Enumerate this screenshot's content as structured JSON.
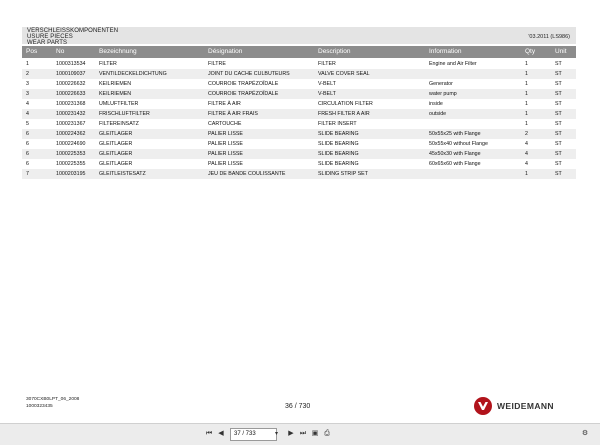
{
  "header": {
    "line1": "VERSCHLEISSKOMPONENTEN",
    "line2": "USURE PIECES",
    "line3": "WEAR PARTS",
    "date_ref": "'03.2011 (LS986)"
  },
  "columns": [
    "Pos",
    "No",
    "Bezeichnung",
    "Désignation",
    "Description",
    "Information",
    "Qty",
    "Unit"
  ],
  "rows": [
    {
      "pos": "1",
      "no": "1000313534",
      "bez": "FILTER",
      "des": "FILTRE",
      "desc": "FILTER",
      "info": "Engine and Air Filter",
      "qty": "1",
      "unit": "ST"
    },
    {
      "pos": "2",
      "no": "1000109037",
      "bez": "VENTILDECKELDICHTUNG",
      "des": "JOINT DU CACHE CULBUTEURS",
      "desc": "VALVE COVER SEAL",
      "info": "",
      "qty": "1",
      "unit": "ST"
    },
    {
      "pos": "3",
      "no": "1000226632",
      "bez": "KEILRIEMEN",
      "des": "COURROIE TRAPÉZOÏDALE",
      "desc": "V-BELT",
      "info": "Generator",
      "qty": "1",
      "unit": "ST"
    },
    {
      "pos": "3",
      "no": "1000226633",
      "bez": "KEILRIEMEN",
      "des": "COURROIE TRAPÉZOÏDALE",
      "desc": "V-BELT",
      "info": "water pump",
      "qty": "1",
      "unit": "ST"
    },
    {
      "pos": "4",
      "no": "1000231368",
      "bez": "UMLUFTFILTER",
      "des": "FILTRE À AIR",
      "desc": "CIRCULATION FILTER",
      "info": "inside",
      "qty": "1",
      "unit": "ST"
    },
    {
      "pos": "4",
      "no": "1000231432",
      "bez": "FRISCHLUFTFILTER",
      "des": "FILTRE À AIR FRAIS",
      "desc": "FRESH FILTER A AIR",
      "info": "outside",
      "qty": "1",
      "unit": "ST"
    },
    {
      "pos": "5",
      "no": "1000231367",
      "bez": "FILTEREINSATZ",
      "des": "CARTOUCHE",
      "desc": "FILTER INSERT",
      "info": "",
      "qty": "1",
      "unit": "ST"
    },
    {
      "pos": "6",
      "no": "1000224362",
      "bez": "GLEITLAGER",
      "des": "PALIER LISSE",
      "desc": "SLIDE BEARING",
      "info": "50x55x25 with Flange",
      "qty": "2",
      "unit": "ST"
    },
    {
      "pos": "6",
      "no": "1000224690",
      "bez": "GLEITLAGER",
      "des": "PALIER LISSE",
      "desc": "SLIDE BEARING",
      "info": "50x55x40 without Flange",
      "qty": "4",
      "unit": "ST"
    },
    {
      "pos": "6",
      "no": "1000225353",
      "bez": "GLEITLAGER",
      "des": "PALIER LISSE",
      "desc": "SLIDE BEARING",
      "info": "45x50x30 with Flange",
      "qty": "4",
      "unit": "ST"
    },
    {
      "pos": "6",
      "no": "1000225355",
      "bez": "GLEITLAGER",
      "des": "PALIER LISSE",
      "desc": "SLIDE BEARING",
      "info": "60x65x60 with Flange",
      "qty": "4",
      "unit": "ST"
    },
    {
      "pos": "7",
      "no": "1000203195",
      "bez": "GLEITLEISTESATZ",
      "des": "JEU DE BANDE COULISSANTE",
      "desc": "SLIDING STRIP SET",
      "info": "",
      "qty": "1",
      "unit": "ST"
    }
  ],
  "footer": {
    "doc_code": "3070CXB0LPT_06_2008",
    "doc_number": "1000323435",
    "page_label": "36 / 730",
    "brand": "WEIDEMANN"
  },
  "toolbar": {
    "page_input": "37 / 733",
    "first_icon": "first-page",
    "prev_icon": "previous-page",
    "next_icon": "next-page",
    "last_icon": "last-page"
  },
  "colors": {
    "header_bg": "#e4e4e4",
    "column_header_bg": "#8c8c8c",
    "row_alt_bg": "#eeeeee",
    "brand_red": "#b1131b"
  }
}
